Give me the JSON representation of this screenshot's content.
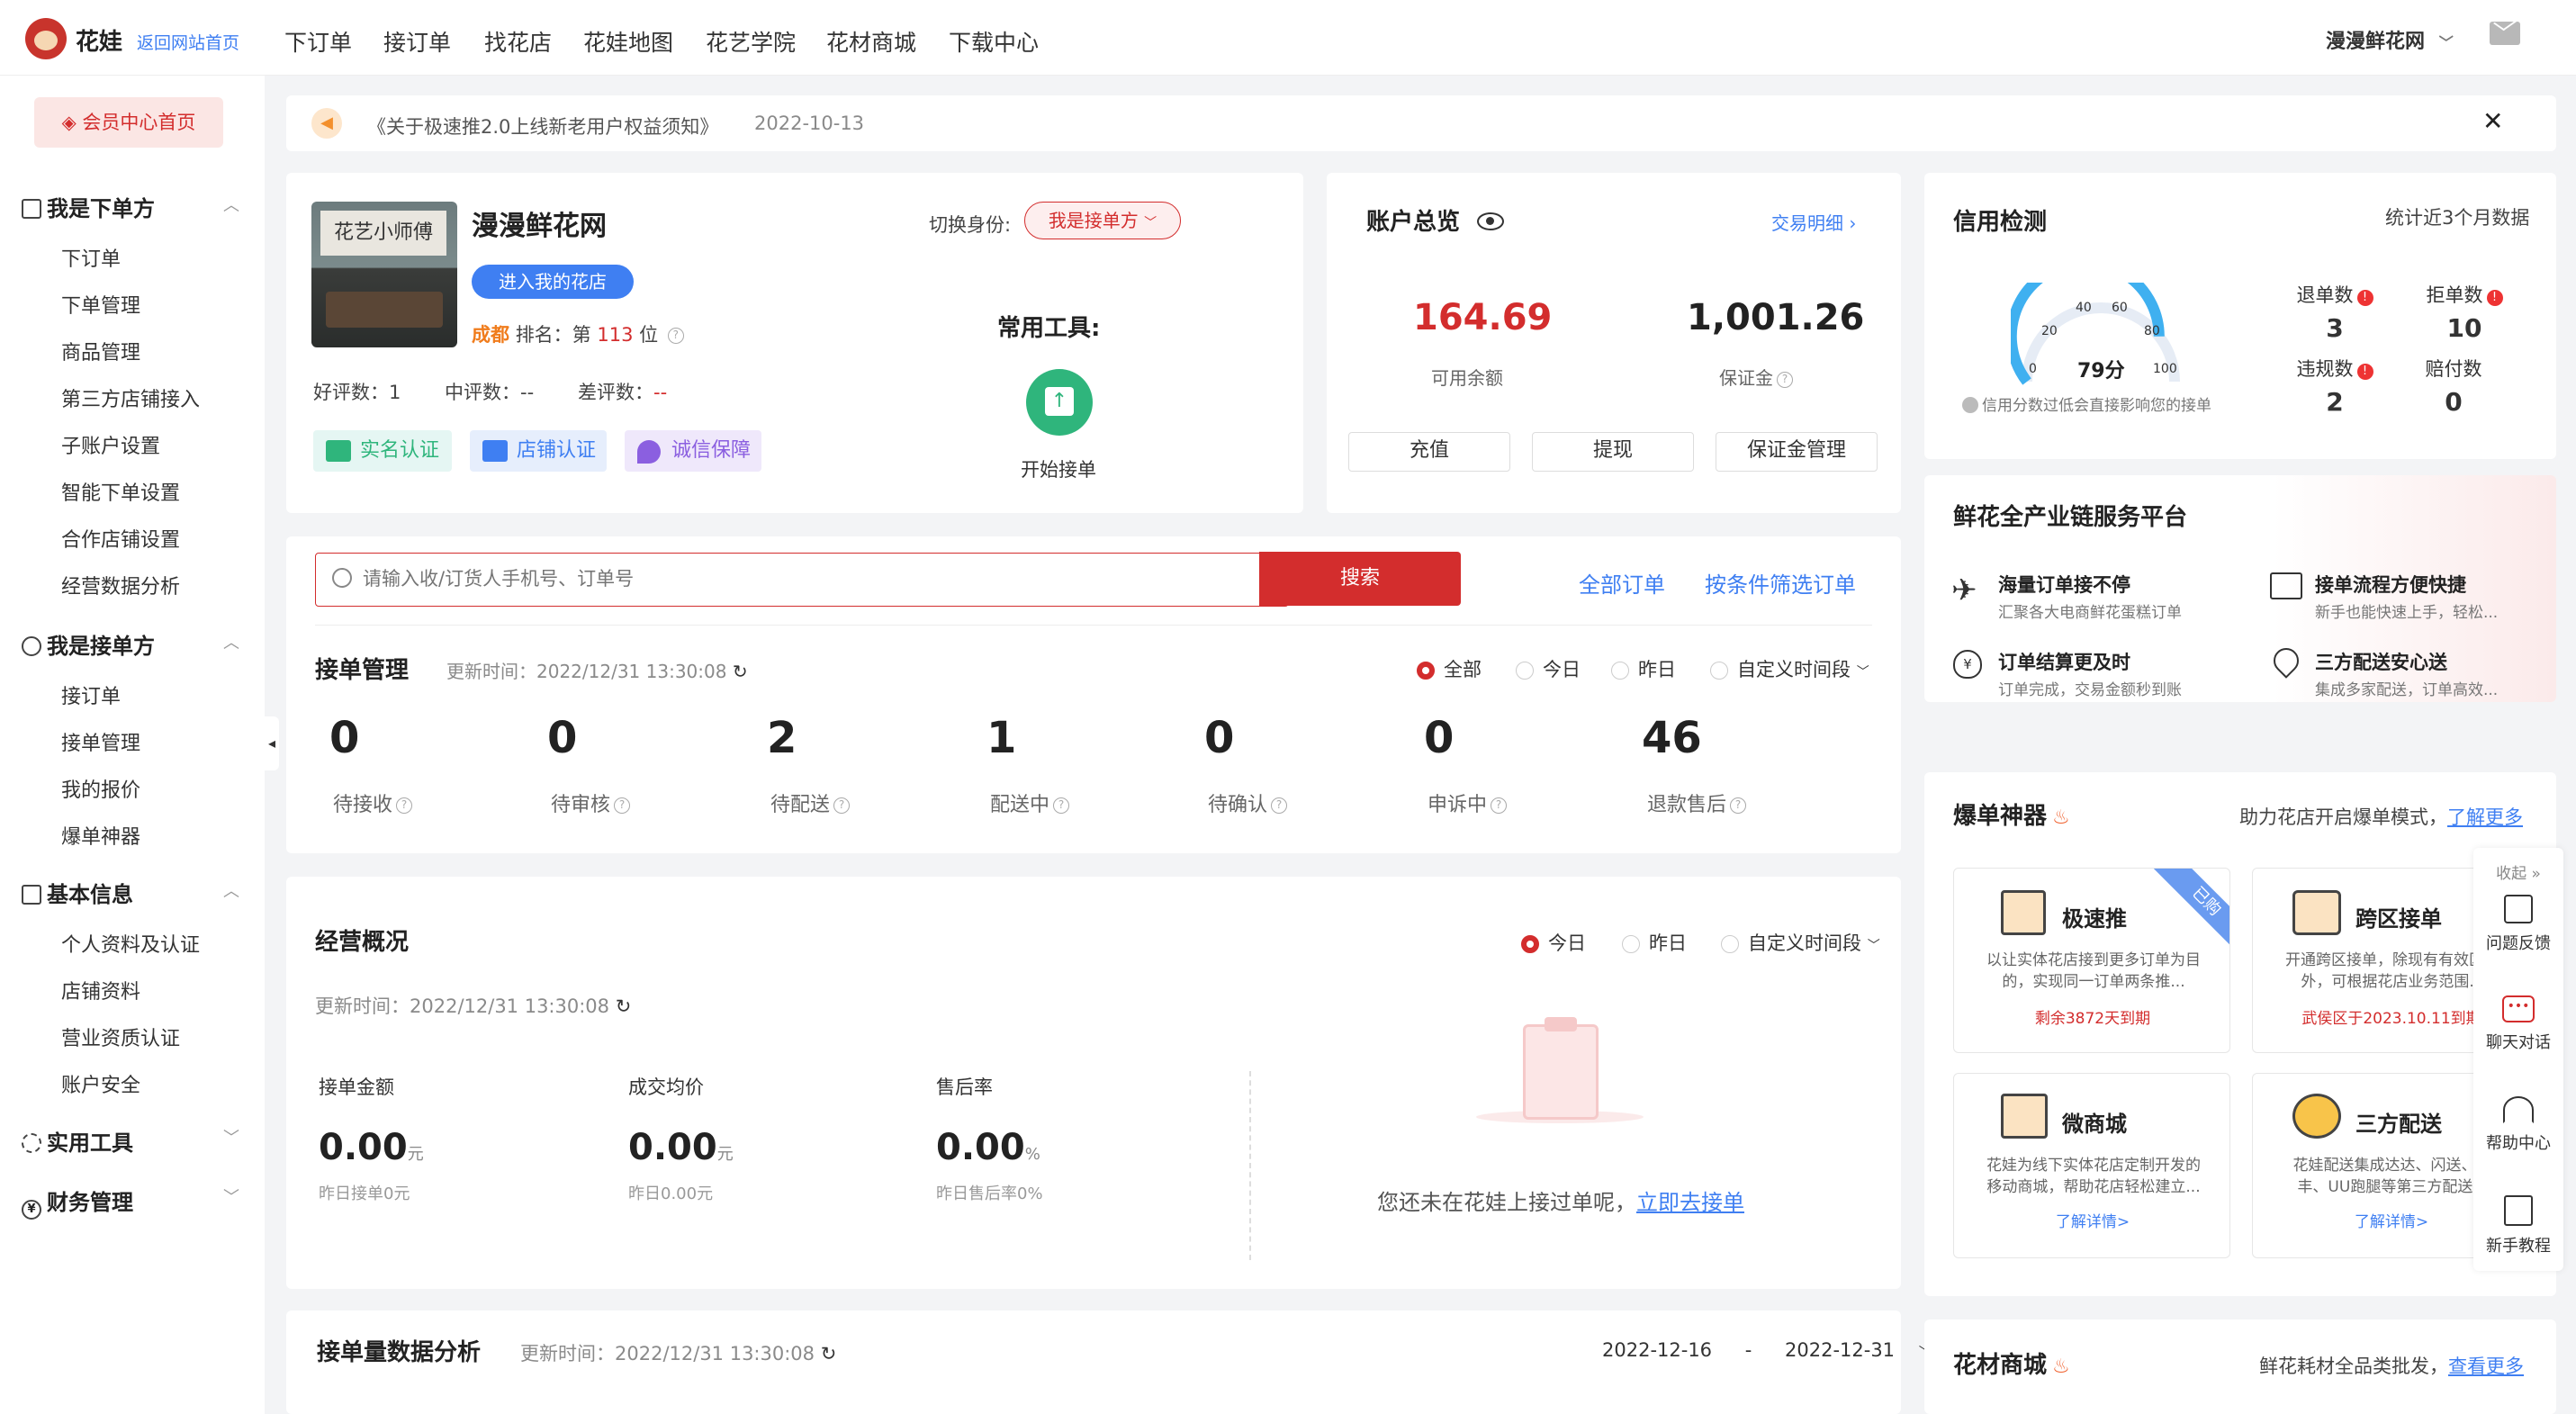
{
  "header": {
    "logo_text": "花娃",
    "back_link": "返回网站首页",
    "nav": [
      "下订单",
      "接订单",
      "找花店",
      "花娃地图",
      "花艺学院",
      "花材商城",
      "下载中心"
    ],
    "shop_name": "漫漫鲜花网"
  },
  "sidebar": {
    "home_button": "会员中心首页",
    "groups": [
      {
        "title": "我是下单方",
        "items": [
          "下订单",
          "下单管理",
          "商品管理",
          "第三方店铺接入",
          "子账户设置",
          "智能下单设置",
          "合作店铺设置",
          "经营数据分析"
        ]
      },
      {
        "title": "我是接单方",
        "items": [
          "接订单",
          "接单管理",
          "我的报价",
          "爆单神器"
        ]
      },
      {
        "title": "基本信息",
        "items": [
          "个人资料及认证",
          "店铺资料",
          "营业资质认证",
          "账户安全"
        ]
      },
      {
        "title": "实用工具",
        "items": []
      },
      {
        "title": "财务管理",
        "items": []
      }
    ]
  },
  "notice": {
    "text": "《关于极速推2.0上线新老用户权益须知》",
    "date": "2022-10-13"
  },
  "profile": {
    "photo_text": "花艺小师傅",
    "name": "漫漫鲜花网",
    "enter_shop": "进入我的花店",
    "city": "成都",
    "rank_prefix": "排名：第",
    "rank": "113",
    "rank_suffix": "位",
    "switch_label": "切换身份:",
    "role": "我是接单方",
    "good_label": "好评数：",
    "good": "1",
    "mid_label": "中评数：",
    "mid": "--",
    "bad_label": "差评数：",
    "bad": "--",
    "tags": [
      "实名认证",
      "店铺认证",
      "诚信保障"
    ],
    "tools_title": "常用工具:",
    "tool_start": "开始接单"
  },
  "account": {
    "title": "账户总览",
    "detail_link": "交易明细",
    "balance": "164.69",
    "balance_label": "可用余额",
    "deposit": "1,001.26",
    "deposit_label": "保证金",
    "buttons": [
      "充值",
      "提现",
      "保证金管理"
    ]
  },
  "credit": {
    "title": "信用检测",
    "note": "统计近3个月数据",
    "score": "79分",
    "gauge_ticks": [
      "0",
      "20",
      "40",
      "60",
      "80",
      "100"
    ],
    "gauge_level": 0.79,
    "hint": "信用分数过低会直接影响您的接单",
    "items": [
      {
        "label": "退单数",
        "value": "3"
      },
      {
        "label": "拒单数",
        "value": "10"
      },
      {
        "label": "违规数",
        "value": "2"
      },
      {
        "label": "赔付数",
        "value": "0"
      }
    ]
  },
  "search": {
    "placeholder": "请输入收/订货人手机号、订单号",
    "button": "搜索",
    "all_orders": "全部订单",
    "filter_orders": "按条件筛选订单"
  },
  "orders": {
    "title": "接单管理",
    "updated": "更新时间：2022/12/31 13:30:08",
    "filters": [
      "全部",
      "今日",
      "昨日",
      "自定义时间段"
    ],
    "stats": [
      {
        "value": "0",
        "label": "待接收"
      },
      {
        "value": "0",
        "label": "待审核"
      },
      {
        "value": "2",
        "label": "待配送"
      },
      {
        "value": "1",
        "label": "配送中"
      },
      {
        "value": "0",
        "label": "待确认"
      },
      {
        "value": "0",
        "label": "申诉中"
      },
      {
        "value": "46",
        "label": "退款售后"
      }
    ]
  },
  "business": {
    "title": "经营概况",
    "filters": [
      "今日",
      "昨日",
      "自定义时间段"
    ],
    "updated": "更新时间：2022/12/31 13:30:08",
    "metrics": [
      {
        "label": "接单金额",
        "value": "0.00",
        "unit": "元",
        "sub": "昨日接单0元"
      },
      {
        "label": "成交均价",
        "value": "0.00",
        "unit": "元",
        "sub": "昨日0.00元"
      },
      {
        "label": "售后率",
        "value": "0.00",
        "unit": "%",
        "sub": "昨日售后率0%"
      }
    ],
    "empty_text": "您还未在花娃上接过单呢，",
    "empty_link": "立即去接单"
  },
  "analysis": {
    "title": "接单量数据分析",
    "updated": "更新时间：2022/12/31 13:30:08",
    "date_from": "2022-12-16",
    "date_sep": "-",
    "date_to": "2022-12-31"
  },
  "platform": {
    "title": "鲜花全产业链服务平台",
    "items": [
      {
        "title": "海量订单接不停",
        "desc": "汇聚各大电商鲜花蛋糕订单"
      },
      {
        "title": "接单流程方便快捷",
        "desc": "新手也能快速上手，轻松..."
      },
      {
        "title": "订单结算更及时",
        "desc": "订单完成，交易金额秒到账"
      },
      {
        "title": "三方配送安心送",
        "desc": "集成多家配送，订单高效..."
      }
    ]
  },
  "booster": {
    "title": "爆单神器",
    "subtitle": "助力花店开启爆单模式，",
    "more": "了解更多",
    "cards": [
      {
        "title": "极速推",
        "desc": "以让实体花店接到更多订单为目的，实现同一订单两条推...",
        "foot": "剩余3872天到期",
        "ribbon": "已购"
      },
      {
        "title": "跨区接单",
        "desc": "开通跨区接单，除现有有效区域外，可根据花店业务范围...",
        "foot": "武侯区于2023.10.11到期"
      },
      {
        "title": "微商城",
        "desc": "花娃为线下实体花店定制开发的移动商城，帮助花店轻松建立...",
        "foot": "了解详情>"
      },
      {
        "title": "三方配送",
        "desc": "花娃配送集成达达、闪送、顺丰、UU跑腿等第三方配送...",
        "foot": "了解详情>"
      }
    ]
  },
  "mall": {
    "title": "花材商城",
    "subtitle": "鲜花耗材全品类批发，",
    "more": "查看更多"
  },
  "float_bar": {
    "collapse": "收起",
    "items": [
      "问题反馈",
      "聊天对话",
      "帮助中心",
      "新手教程"
    ]
  },
  "colors": {
    "accent": "#d32d2d",
    "link": "#3f7ff2",
    "green": "#2fb57c"
  }
}
